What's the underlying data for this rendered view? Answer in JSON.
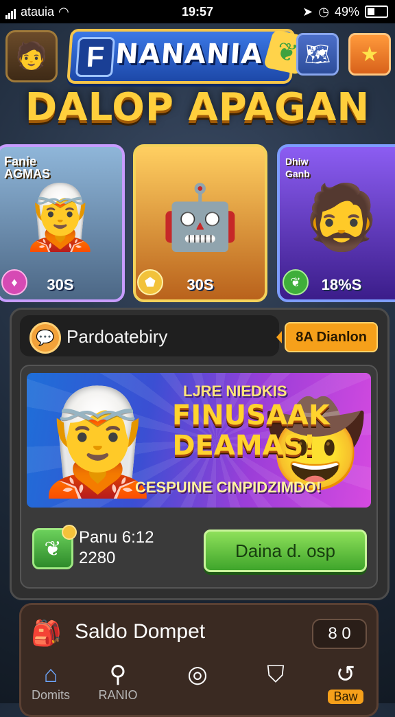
{
  "status_bar": {
    "carrier": "atauia",
    "time": "19:57",
    "battery": "49%"
  },
  "header": {
    "logo_letter": "F",
    "logo_text": "NANANIA",
    "headline": "DALOP APAGAN"
  },
  "heroes": [
    {
      "label": "Fanie\nAGMAS",
      "value": "30S",
      "badge_icon": "gem-icon"
    },
    {
      "label": "",
      "value": "30S",
      "badge_icon": "shield-icon"
    },
    {
      "label": "Dhiw\nGanb",
      "value": "18%S",
      "badge_icon": "leaf-icon"
    }
  ],
  "panel": {
    "player_name": "Pardoatebiry",
    "tag_label": "8A Dianlon",
    "banner": {
      "subtitle": "LJRE NIEDKIS",
      "title": "FINUSAAK DEAMAS!",
      "tagline": "CESPUINE CINPIDZIMDO!"
    },
    "stat_line1": "Panu 6:12",
    "stat_line2": "2280",
    "action_label": "Daina d. osp"
  },
  "wallet": {
    "title": "Saldo Dompet",
    "count": "8 0"
  },
  "nav": [
    {
      "label": "Domits",
      "icon": "home-icon"
    },
    {
      "label": "RANIO",
      "icon": "search-icon"
    },
    {
      "label": "",
      "icon": "compass-icon"
    },
    {
      "label": "",
      "icon": "shield-icon"
    },
    {
      "label": "Baw",
      "icon": "refresh-icon"
    }
  ],
  "colors": {
    "accent_gold": "#ffcf3c",
    "action_green": "#6ecf46",
    "tag_orange": "#f6a01a"
  }
}
